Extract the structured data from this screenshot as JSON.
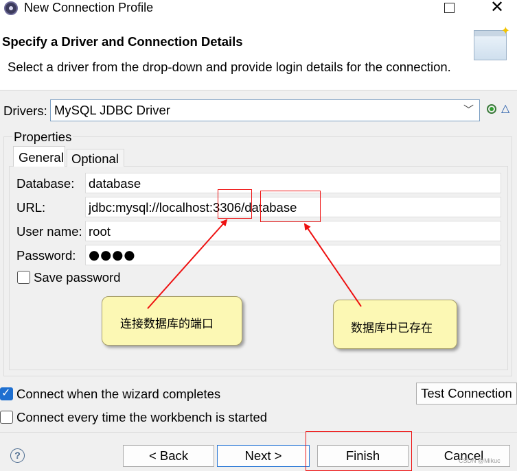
{
  "window": {
    "title": "New Connection Profile",
    "maximize_icon": "maximize-icon",
    "close_glyph": "✕"
  },
  "header": {
    "title": "Specify a Driver and Connection Details",
    "description": "Select a driver from the drop-down and provide login details for the connection."
  },
  "drivers": {
    "label": "Drivers:",
    "selected": "MySQL JDBC Driver",
    "chevron": "﹀",
    "edit_glyph": "△"
  },
  "properties": {
    "group_label": "Properties",
    "tabs": [
      {
        "label": "General",
        "active": true
      },
      {
        "label": "Optional",
        "active": false
      }
    ],
    "fields": {
      "database": {
        "label": "Database:",
        "value": "database"
      },
      "url": {
        "label": "URL:",
        "value": "jdbc:mysql://localhost:3306/database"
      },
      "user": {
        "label": "User name:",
        "value": "root"
      },
      "password": {
        "label": "Password:",
        "value": "●●●●"
      }
    },
    "save_password": {
      "label": "Save password",
      "checked": false
    }
  },
  "annotations": {
    "port_note": "连接数据库的端口",
    "db_note": "数据库中已存在",
    "highlight_color": "#ee1111",
    "note_color": "#fcf8b4"
  },
  "options": {
    "connect_on_complete": {
      "label": "Connect when the wizard completes",
      "checked": true
    },
    "connect_every_time": {
      "label": "Connect every time the workbench is started",
      "checked": false
    }
  },
  "buttons": {
    "test_connection": "Test Connection",
    "back": "< Back",
    "next": "Next >",
    "finish": "Finish",
    "cancel": "Cancel",
    "help": "?"
  },
  "watermark": "CSDN @Mikuc",
  "colors": {
    "accent": "#1e6fd0",
    "background": "#f0f0f0"
  }
}
